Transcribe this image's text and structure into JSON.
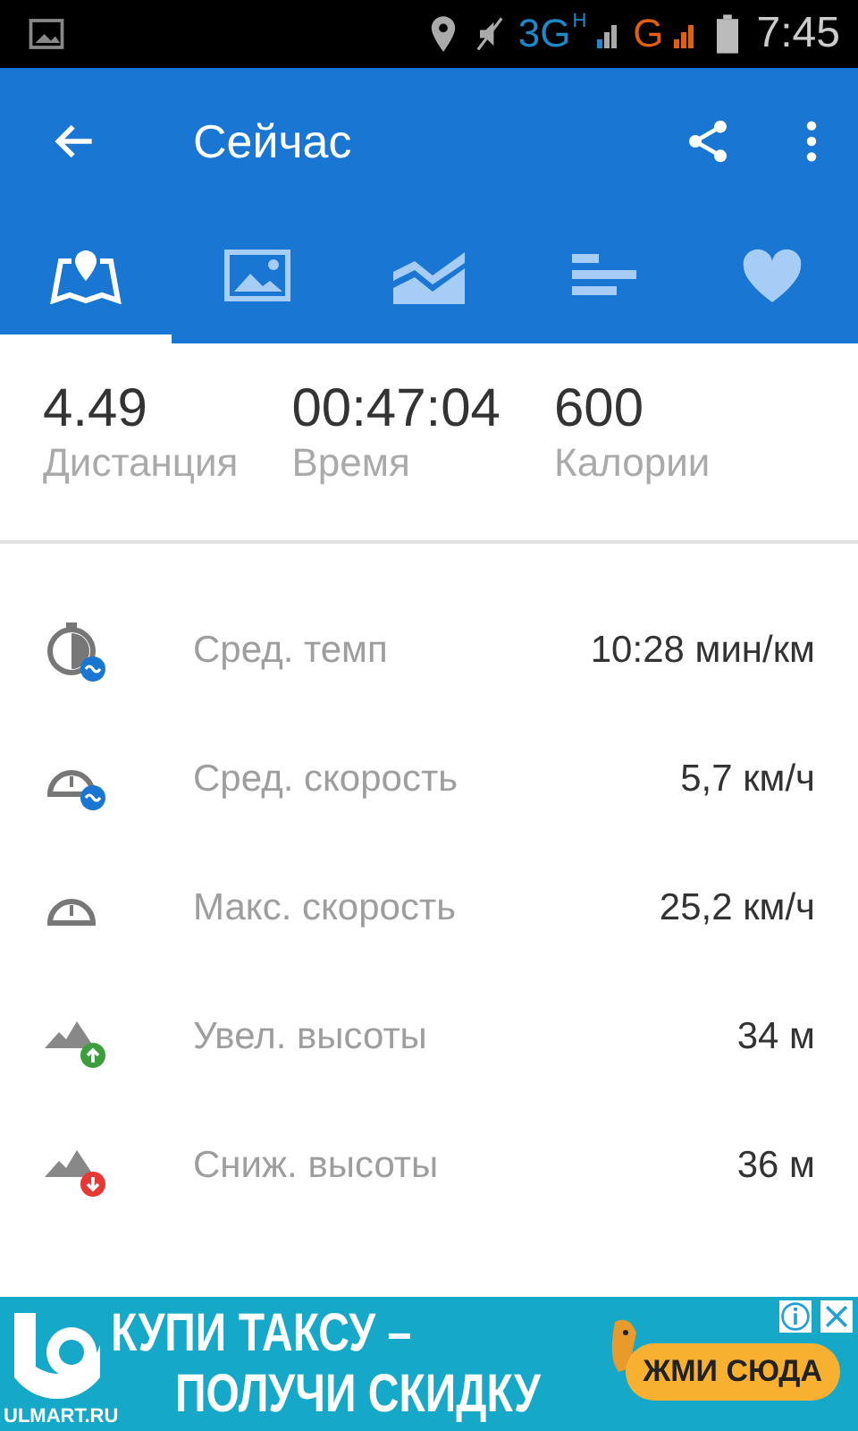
{
  "status_bar": {
    "network_1": "3G",
    "network_1_sub": "H",
    "network_2": "G",
    "time": "7:45"
  },
  "app_bar": {
    "title": "Сейчас"
  },
  "tabs": [
    {
      "kind": "map",
      "selected": true
    },
    {
      "kind": "photo",
      "selected": false
    },
    {
      "kind": "chart",
      "selected": false
    },
    {
      "kind": "splits",
      "selected": false
    },
    {
      "kind": "heart",
      "selected": false
    }
  ],
  "summary": [
    {
      "value": "4.49",
      "label": "Дистанция"
    },
    {
      "value": "00:47:04",
      "label": "Время"
    },
    {
      "value": "600",
      "label": "Калории"
    }
  ],
  "stats": [
    {
      "kind": "pace",
      "label": "Сред. темп",
      "value": "10:28 мин/км"
    },
    {
      "kind": "avg_speed",
      "label": "Сред. скорость",
      "value": "5,7 км/ч"
    },
    {
      "kind": "max_speed",
      "label": "Макс. скорость",
      "value": "25,2 км/ч"
    },
    {
      "kind": "climb",
      "label": "Увел. высоты",
      "value": "34 м"
    },
    {
      "kind": "descent",
      "label": "Сниж. высоты",
      "value": "36 м"
    }
  ],
  "ad": {
    "headline_1": "КУПИ ТАКСУ –",
    "headline_2": "ПОЛУЧИ СКИДКУ",
    "domain": "ULMART.RU",
    "button": "ЖМИ СЮДА"
  }
}
